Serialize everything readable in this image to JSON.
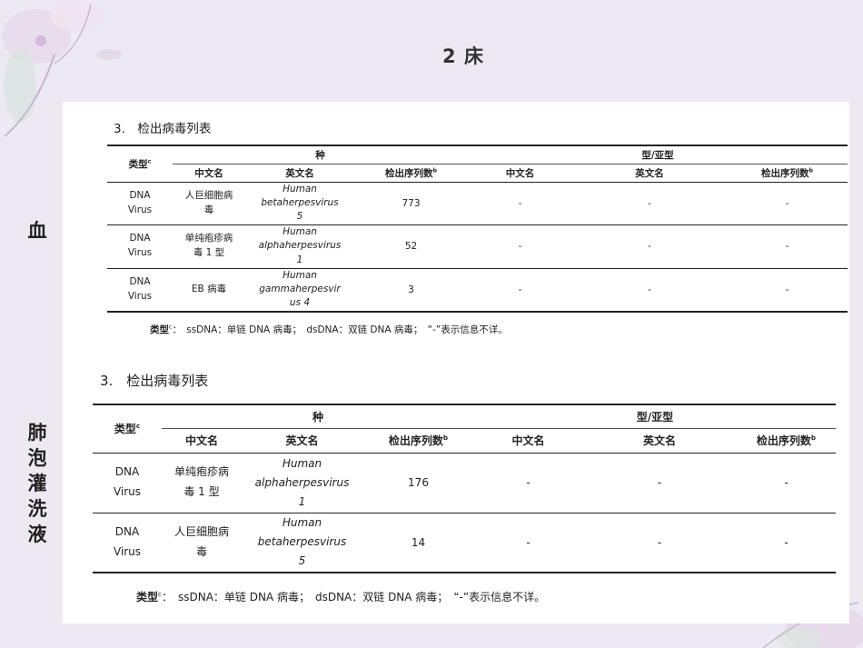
{
  "slide": {
    "title": "2 床",
    "side_label_1": "血",
    "side_label_2": [
      "肺",
      "泡",
      "灌",
      "洗",
      "液"
    ]
  },
  "table1": {
    "section_title": "3.　检出病毒列表",
    "type_header": "类型",
    "type_sup": "c",
    "species_header": "种",
    "subtype_header": "型/亚型",
    "columns": [
      "中文名",
      "英文名",
      "检出序列数",
      "中文名",
      "英文名",
      "检出序列数"
    ],
    "count_sup": "b",
    "rows": [
      {
        "type": [
          "DNA",
          "Virus"
        ],
        "cn": [
          "人巨细胞病",
          "毒"
        ],
        "en": [
          "Human",
          "betaherpesvirus",
          "5"
        ],
        "count": "773",
        "sub_cn": "-",
        "sub_en": "-",
        "sub_count": "-"
      },
      {
        "type": [
          "DNA",
          "Virus"
        ],
        "cn": [
          "单纯疱疹病",
          "毒 1 型"
        ],
        "en": [
          "Human",
          "alphaherpesvirus",
          "1"
        ],
        "count": "52",
        "sub_cn": "-",
        "sub_en": "-",
        "sub_count": "-"
      },
      {
        "type": [
          "DNA",
          "Virus"
        ],
        "cn": [
          "EB 病毒"
        ],
        "en": [
          "Human",
          "gammaherpesvir",
          "us 4"
        ],
        "count": "3",
        "sub_cn": "-",
        "sub_en": "-",
        "sub_count": "-"
      }
    ],
    "note_label": "类型",
    "note_sup": "c",
    "note_text": "：　ssDNA：单链 DNA 病毒；　dsDNA：双链 DNA 病毒；　“-”表示信息不详。"
  },
  "table2": {
    "section_title": "3.　检出病毒列表",
    "type_header": "类型",
    "type_sup": "c",
    "species_header": "种",
    "subtype_header": "型/亚型",
    "columns": [
      "中文名",
      "英文名",
      "检出序列数",
      "中文名",
      "英文名",
      "检出序列数"
    ],
    "count_sup": "b",
    "rows": [
      {
        "type": [
          "DNA",
          "Virus"
        ],
        "cn": [
          "单纯疱疹病",
          "毒 1 型"
        ],
        "en": [
          "Human",
          "alphaherpesvirus",
          "1"
        ],
        "count": "176",
        "sub_cn": "-",
        "sub_en": "-",
        "sub_count": "-"
      },
      {
        "type": [
          "DNA",
          "Virus"
        ],
        "cn": [
          "人巨细胞病",
          "毒"
        ],
        "en": [
          "Human",
          "betaherpesvirus",
          "5"
        ],
        "count": "14",
        "sub_cn": "-",
        "sub_en": "-",
        "sub_count": "-"
      }
    ],
    "note_label": "类型",
    "note_sup": "c",
    "note_text": "：　ssDNA：单链 DNA 病毒；　dsDNA：双链 DNA 病毒；　“-”表示信息不详。"
  },
  "colors": {
    "background": "#ece9f2",
    "panel": "#ffffff",
    "accent_flower": "#d9c4de"
  }
}
